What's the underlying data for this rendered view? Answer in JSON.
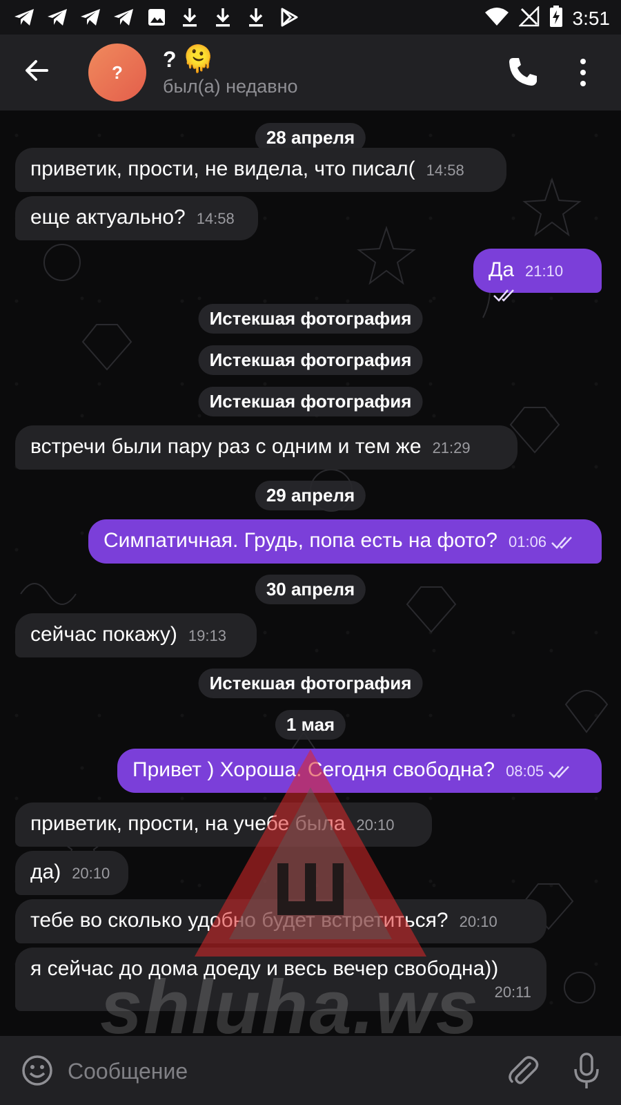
{
  "status_bar": {
    "time": "3:51",
    "left_icons": [
      "telegram-icon",
      "telegram-icon",
      "telegram-icon",
      "telegram-icon",
      "image-icon",
      "download-icon",
      "download-icon",
      "download-icon",
      "play-store-icon"
    ],
    "right_icons": [
      "wifi-icon",
      "no-signal-icon",
      "battery-charging-icon"
    ]
  },
  "header": {
    "avatar_letter": "?",
    "name": "?",
    "name_emoji": "🫠",
    "last_seen": "был(а) недавно"
  },
  "chat": {
    "dates": [
      "28 апреля",
      "29 апреля",
      "30 апреля",
      "1 мая"
    ],
    "expired_photo_label": "Истекшая фотография",
    "messages": [
      {
        "dir": "in",
        "text": "приветик, прости, не видела, что писал(",
        "time": "14:58"
      },
      {
        "dir": "in",
        "text": "еще актуально?",
        "time": "14:58"
      },
      {
        "dir": "out",
        "text": "Да",
        "time": "21:10"
      },
      {
        "dir": "in",
        "text": "встречи были пару раз с одним и тем же",
        "time": "21:29"
      },
      {
        "dir": "out",
        "text": "Симпатичная. Грудь, попа есть на фото?",
        "time": "01:06"
      },
      {
        "dir": "in",
        "text": "сейчас покажу)",
        "time": "19:13"
      },
      {
        "dir": "out",
        "text": "Привет ) Хороша. Сегодня свободна?",
        "time": "08:05"
      },
      {
        "dir": "in",
        "text": "приветик, прости, на учебе была",
        "time": "20:10"
      },
      {
        "dir": "in",
        "text": "да)",
        "time": "20:10"
      },
      {
        "dir": "in",
        "text": "тебе во сколько удобно будет встретиться?",
        "time": "20:10"
      },
      {
        "dir": "in",
        "text": "я сейчас до дома доеду и весь вечер свободна))",
        "time": "20:11"
      }
    ]
  },
  "watermark": {
    "text": "shluha.ws"
  },
  "composer": {
    "placeholder": "Сообщение"
  },
  "colors": {
    "outgoing_bubble": "#7b3fd9",
    "incoming_bubble": "#232326",
    "header_bg": "#212124",
    "background": "#0b0b0c"
  }
}
